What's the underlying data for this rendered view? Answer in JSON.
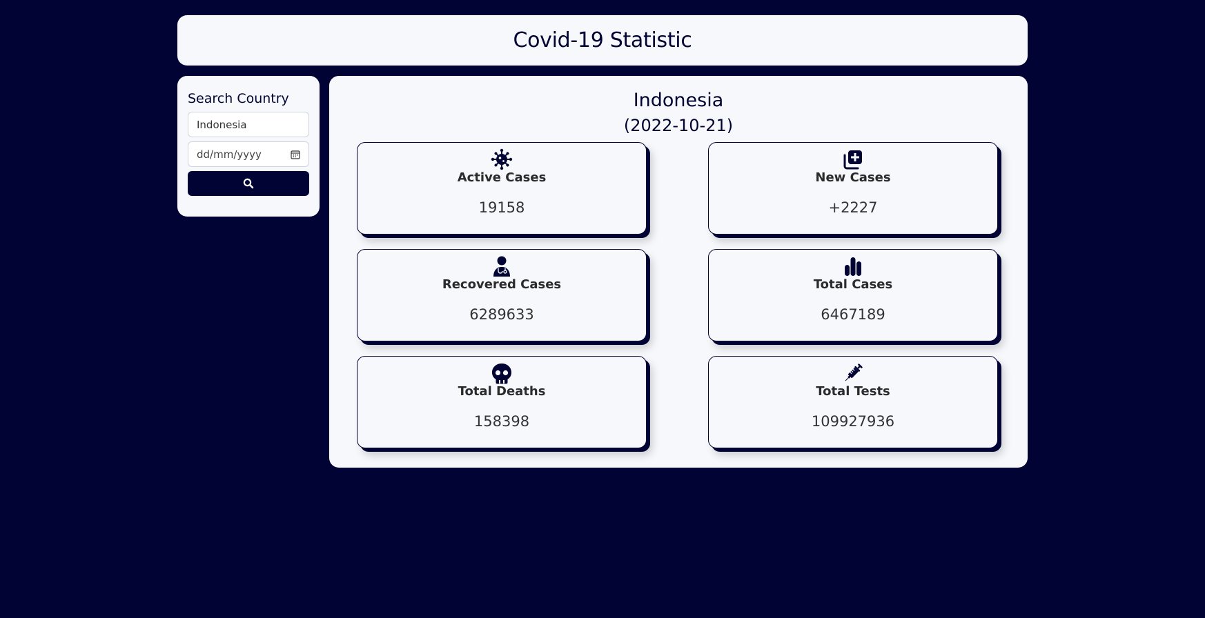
{
  "header": {
    "title": "Covid-19 Statistic"
  },
  "search": {
    "title": "Search Country",
    "country_value": "Indonesia",
    "date_placeholder": "dd/mm/yyyy",
    "button_icon": "search-icon"
  },
  "main": {
    "country": "Indonesia",
    "date": "(2022-10-21)",
    "cards": [
      {
        "label": "Active Cases",
        "value": "19158",
        "icon": "virus-icon"
      },
      {
        "label": "New Cases",
        "value": "+2227",
        "icon": "plus-square-icon"
      },
      {
        "label": "Recovered Cases",
        "value": "6289633",
        "icon": "doctor-icon"
      },
      {
        "label": "Total Cases",
        "value": "6467189",
        "icon": "bar-chart-icon"
      },
      {
        "label": "Total Deaths",
        "value": "158398",
        "icon": "skull-icon"
      },
      {
        "label": "Total Tests",
        "value": "109927936",
        "icon": "syringe-icon"
      }
    ]
  },
  "colors": {
    "background": "#000333",
    "panel": "#f6f8fb",
    "accent": "#000333",
    "text": "#333333"
  }
}
